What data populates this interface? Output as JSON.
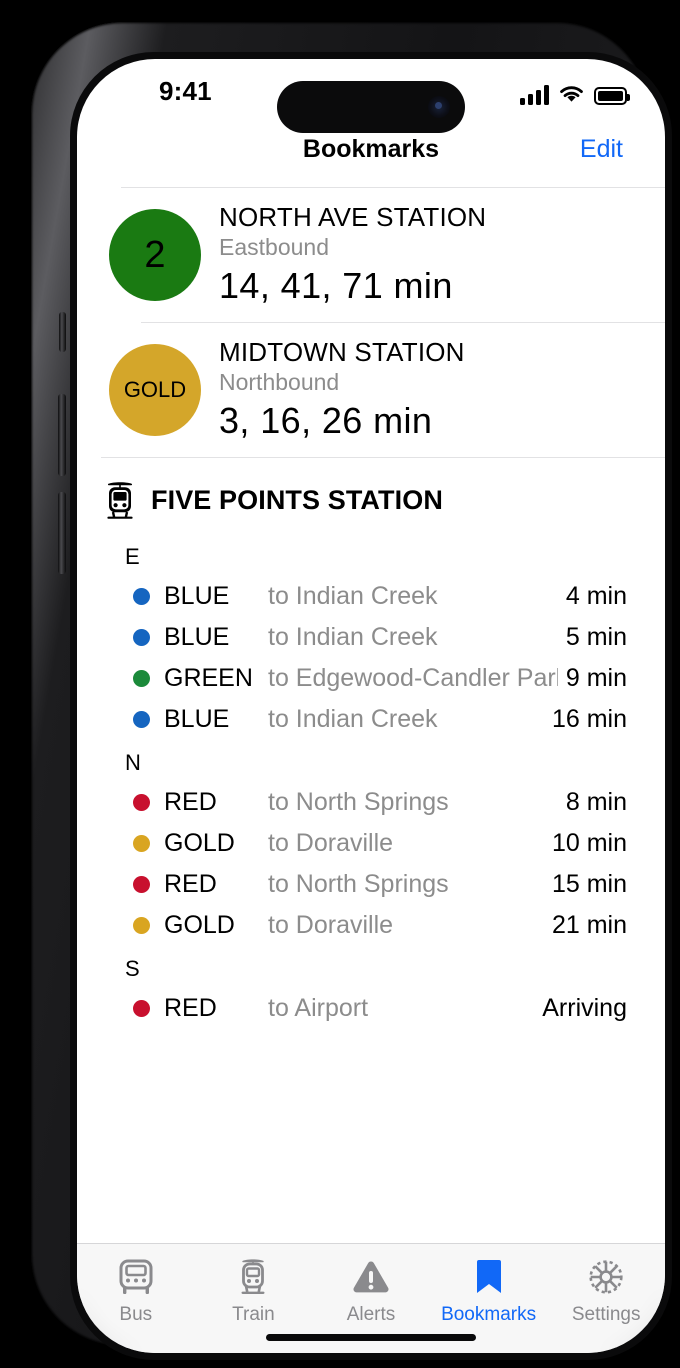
{
  "status_bar": {
    "time": "9:41",
    "signal_icon": "cellular-signal-icon",
    "wifi_icon": "wifi-icon",
    "battery_icon": "battery-full-icon"
  },
  "nav": {
    "title": "Bookmarks",
    "edit_label": "Edit",
    "edit_color": "#1168f7"
  },
  "bookmarks": [
    {
      "badge_text": "2",
      "badge_color": "#1a7a12",
      "badge_type": "number",
      "station": "NORTH AVE STATION",
      "direction": "Eastbound",
      "times": "14, 41, 71 min"
    },
    {
      "badge_text": "GOLD",
      "badge_color": "#d4a62a",
      "badge_type": "text",
      "station": "MIDTOWN STATION",
      "direction": "Northbound",
      "times": "3, 16, 26 min"
    }
  ],
  "station_section": {
    "icon": "tram-icon",
    "name": "FIVE POINTS STATION",
    "groups": [
      {
        "label": "E",
        "departures": [
          {
            "route": "BLUE",
            "color": "#1565c0",
            "destination": "to Indian Creek",
            "time": "4 min"
          },
          {
            "route": "BLUE",
            "color": "#1565c0",
            "destination": "to Indian Creek",
            "time": "5 min"
          },
          {
            "route": "GREEN",
            "color": "#1b8a3a",
            "destination": "to Edgewood-Candler Park",
            "time": "9 min"
          },
          {
            "route": "BLUE",
            "color": "#1565c0",
            "destination": "to Indian Creek",
            "time": "16 min"
          }
        ]
      },
      {
        "label": "N",
        "departures": [
          {
            "route": "RED",
            "color": "#c8102e",
            "destination": "to North Springs",
            "time": "8 min"
          },
          {
            "route": "GOLD",
            "color": "#d9a521",
            "destination": "to Doraville",
            "time": "10 min"
          },
          {
            "route": "RED",
            "color": "#c8102e",
            "destination": "to North Springs",
            "time": "15 min"
          },
          {
            "route": "GOLD",
            "color": "#d9a521",
            "destination": "to Doraville",
            "time": "21 min"
          }
        ]
      },
      {
        "label": "S",
        "departures": [
          {
            "route": "RED",
            "color": "#c8102e",
            "destination": "to Airport",
            "time": "Arriving"
          }
        ]
      }
    ]
  },
  "tabbar": {
    "active_color": "#1168f7",
    "inactive_color": "#8a8a8d",
    "tabs": [
      {
        "label": "Bus",
        "icon": "bus-icon",
        "active": false
      },
      {
        "label": "Train",
        "icon": "tram-icon",
        "active": false
      },
      {
        "label": "Alerts",
        "icon": "warning-icon",
        "active": false
      },
      {
        "label": "Bookmarks",
        "icon": "bookmark-icon",
        "active": true
      },
      {
        "label": "Settings",
        "icon": "gear-icon",
        "active": false
      }
    ]
  }
}
